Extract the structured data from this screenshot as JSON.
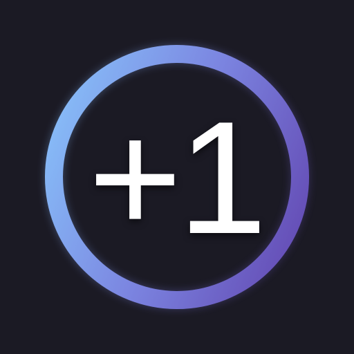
{
  "icon": {
    "label": "+1",
    "ring_icon": "ring-icon",
    "colors": {
      "background": "#1b1a24",
      "ring_start": "#86b9f6",
      "ring_end": "#6650b8",
      "text": "#ffffff"
    }
  }
}
